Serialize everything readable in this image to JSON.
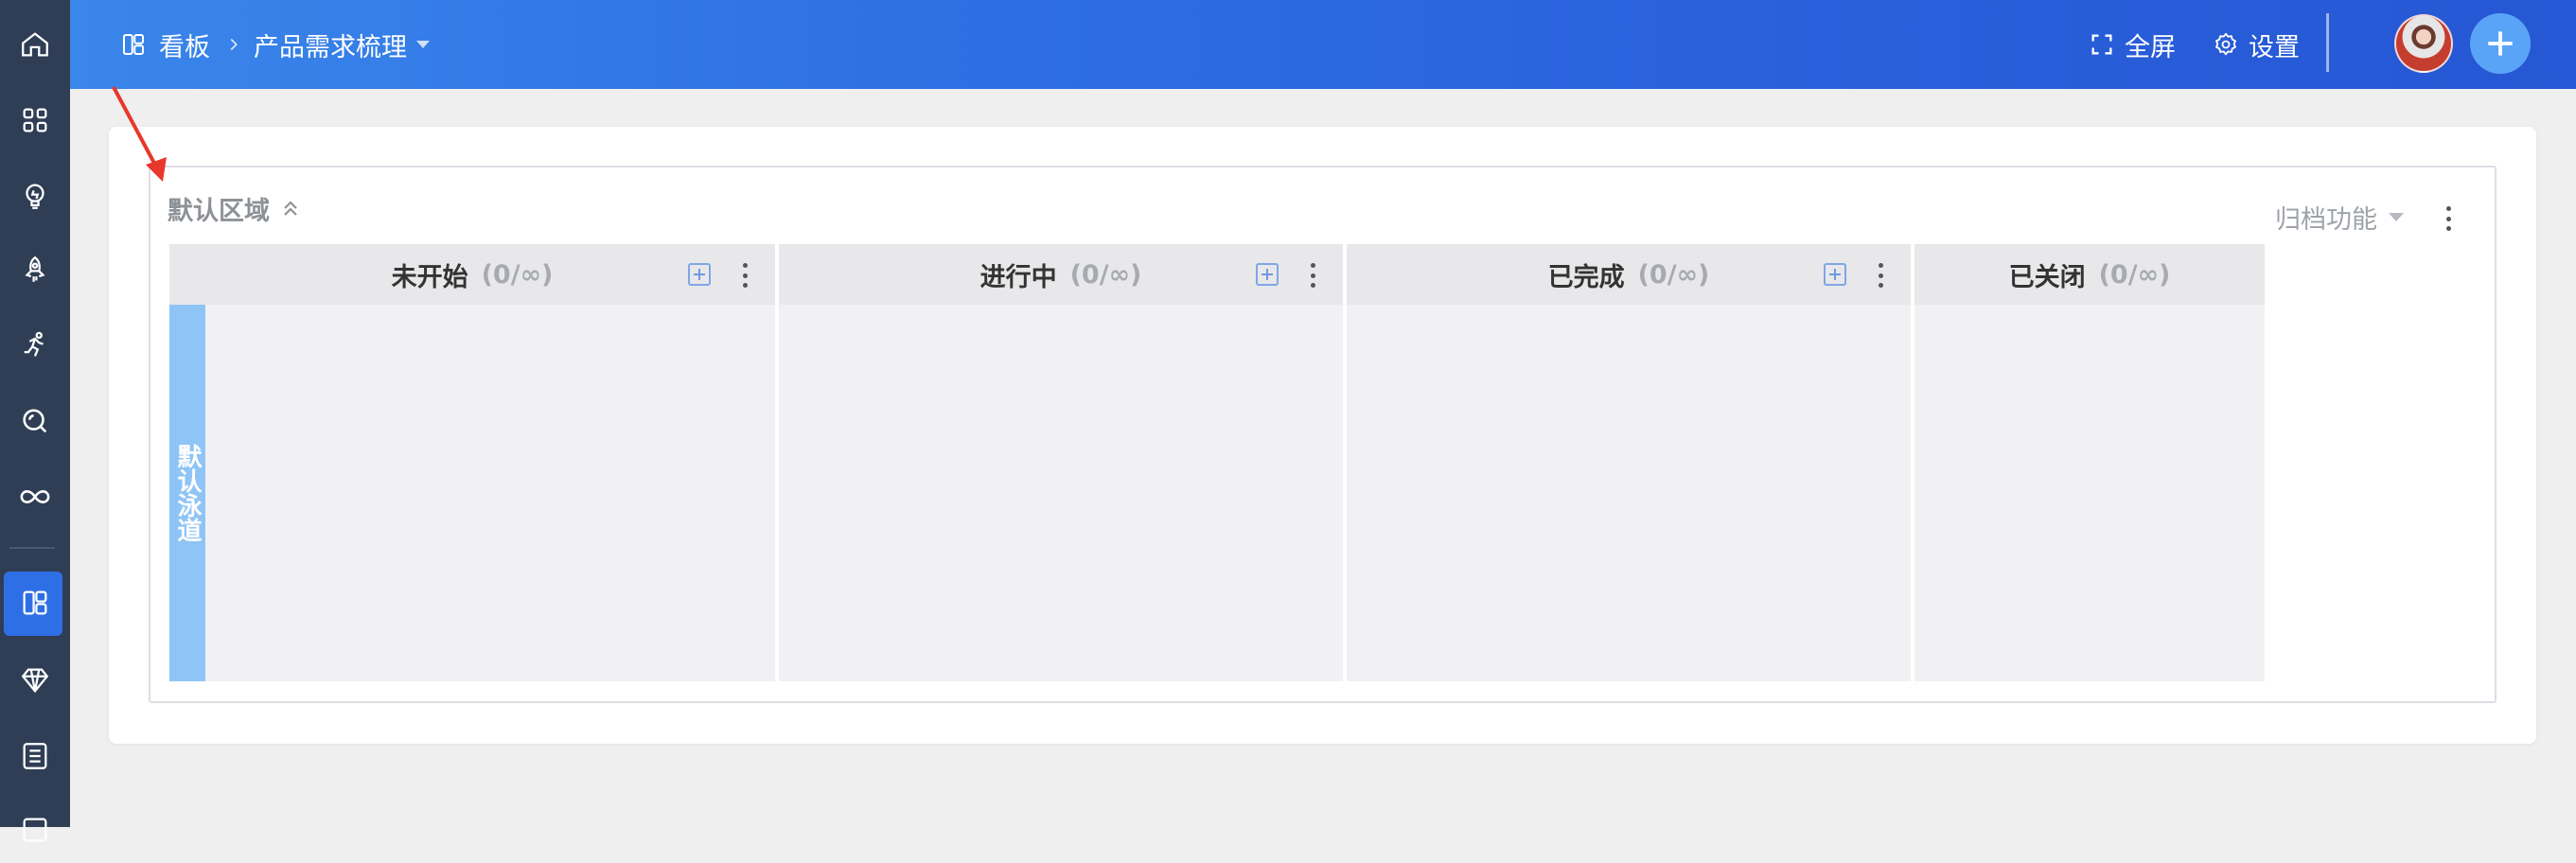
{
  "header": {
    "board_label": "看板",
    "project_name": "产品需求梳理",
    "fullscreen_label": "全屏",
    "settings_label": "设置"
  },
  "region": {
    "title": "默认区域",
    "archive_label": "归档功能"
  },
  "columns": [
    {
      "title": "未开始",
      "count": "(0/∞)"
    },
    {
      "title": "进行中",
      "count": "(0/∞)"
    },
    {
      "title": "已完成",
      "count": "(0/∞)"
    },
    {
      "title": "已关闭",
      "count": "(0/∞)"
    }
  ],
  "lane": {
    "label": "默认泳道"
  },
  "colors": {
    "rail_bg": "#2f3e55",
    "rail_active": "#2f6fe6",
    "header_start": "#3a86ea",
    "header_end": "#2657d4",
    "lane_bg": "#8ec4f6",
    "annotation_arrow": "#e8372b"
  }
}
